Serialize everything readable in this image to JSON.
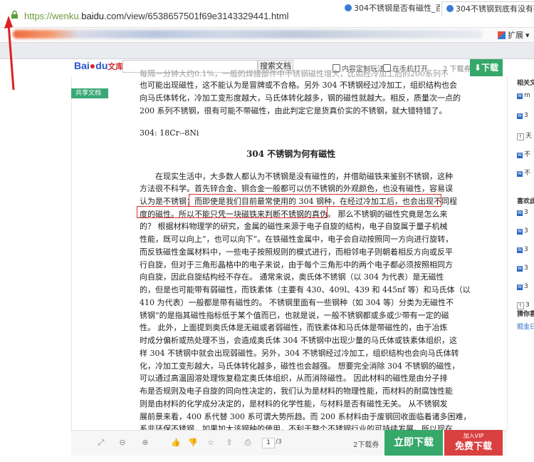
{
  "browser": {
    "url_prefix": "https://wenku.",
    "url_domain": "baidu",
    "url_suffix": ".com/view/6538657501f69e3143329441.html",
    "extension_label": "扩展",
    "tabs": [
      {
        "label": "304不锈钢是否有磁性_百度搜索",
        "close": "×"
      },
      {
        "label": "304不锈钢到底有没有磁性 - 百",
        "close": "×"
      }
    ]
  },
  "header": {
    "logo_bai": "Bai",
    "logo_du": "du",
    "logo_wenku": "文库",
    "search_button": "搜索文档",
    "link_play": "内容定制玩法",
    "link_phone": "在手机打开",
    "page_count": "2 下载券",
    "download_label": "下载"
  },
  "share_label": "共享文档",
  "document": {
    "lines": [
      "每隔一分钟大约0.1%，一般的焊接部件中不锈钢磁性增大，比如经冷加工后的200系列不",
      "也可能出现磁性，这不能认为是冒牌或不合格。另外 304 不锈钢经过冷加工，组织结构也会",
      "向马氏体转化，冷加工变形度越大，马氏体转化越多，钢的磁性就越大。相反，质量次一点的",
      "200 系列不锈钢，很有可能不带磁性，由此判定它是货真价实的不锈钢，就大错特错了。",
      "304:      18Cr--8Ni",
      "304 不锈钢为何有磁性",
      "在现实生活中，大多数人都认为不锈钢是没有磁性的，并借助磁铁来鉴别不锈钢，这种",
      "方法很不科学。首先锌合金、铜合金一般都可以仿不锈钢的外观颜色，也没有磁性，容易误",
      "认为是不锈钢；而即使是我们目前最常使用的 304 钢种，在经过冷加工后，也会出现不同程",
      "度的磁性。所以不能只凭一块磁铁来判断不锈钢的真伪。   那么不锈钢的磁性究竟是怎么来",
      "的？ 根据材料物理学的研究，金属的磁性来源于电子自旋的结构，电子自旋属于量子机械",
      "性能，既可以向上”，也可以向下”。在铁磁性金属中，电子会自动按照同一方向进行旋转，",
      "而反铁磁性金属材料中，一些电子按照规则的模式进行，而相邻电子则朝着相反方向或反平",
      "行自旋，但对于三角形晶格中的电子来说，由于每个三角形中的两个电子都必须按照相同方",
      "向自旋，因此自旋结构经不存在。 通常来说，奥氏体不锈钢（以 304 为代表）是无磁性",
      "的，但是也可能带有弱磁性，而铁素体（主要有 430、409l、439 和 445nf 等）和马氏体（以",
      "410 为代表）一般都是带有磁性的。 不锈钢里面有一些钢种（如 304 等）分类为无磁性不",
      "锈钢”的是指其磁性指标低于某个值而已，也就是说，一般不锈钢都或多或少带有一定的磁",
      "性。 此外，上面提到奥氏体是无磁或者弱磁性，而铁素体和马氏体是带磁性的，由于冶炼",
      "时成分偏析或热处理不当，会造成奥氏体 304 不锈钢中出现少量的马氏体或铁素体组织，这",
      "样 304 不锈钢中就会出现弱磁性。另外，304 不锈钢经过冷加工，组织结构也会向马氏体转",
      "化，冷加工变形越大，马氏体转化越多，磁性也会越强。 想要完全消除 304 不锈钢的磁性，",
      "可以通过高温固溶处理恢复稳定奥氏体组织，从而消除磁性。 因此材料的磁性是由分子排",
      "布是否规则及电子自旋的同向性决定的，我们认为是材料的物理性能，而材料的耐腐蚀性能",
      "则是由材料的化学成分决定的，是材料的化学性能，与材料是否有磁性无关。  从不锈钢发",
      "展前景来看，400 系代替 300 系可谓大势所趋。而 200 系材料由于废钢回收面临着诸多困难，",
      "系非环保不锈钢，如果加大该钢种的使用，不利于整个不锈钢行业的可持续发展，所以现在"
    ]
  },
  "sidebar": {
    "related": "相关文",
    "popular": "喜欢此",
    "guess": "猜你喜",
    "guess_sub": "掘金日",
    "items": [
      "m",
      "3",
      "天",
      "不",
      "不",
      "3",
      "3",
      "3",
      "3",
      "3",
      "3"
    ]
  },
  "bottom": {
    "page_current": "1",
    "page_total": "/3",
    "ticket": "2下载券",
    "download_now": "立即下载",
    "vip_join": "加入VIP",
    "vip_free": "免费下载"
  },
  "colors": {
    "green": "#35a86a",
    "red": "#d94040",
    "highlight": "#e03030",
    "arrow": "#e02020"
  }
}
